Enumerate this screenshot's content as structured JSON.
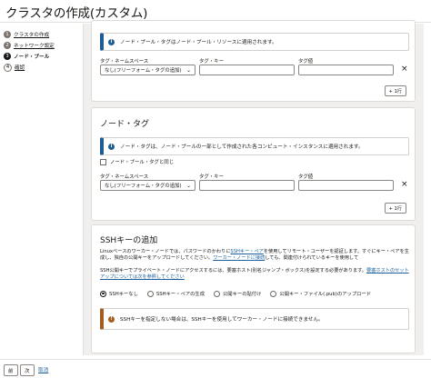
{
  "page": {
    "title": "クラスタの作成(カスタム)"
  },
  "steps": [
    {
      "num": "1",
      "label": "クラスタの作成"
    },
    {
      "num": "2",
      "label": "ネットワーク設定"
    },
    {
      "num": "3",
      "label": "ノード・プール"
    },
    {
      "num": "4",
      "label": "確認"
    }
  ],
  "pool_tags": {
    "info": "ノード・プール・タグはノード・プール・リソースに適用されます。",
    "namespace_label": "タグ・ネームスペース",
    "key_label": "タグ・キー",
    "value_label": "タグ値",
    "namespace_value": "なし(フリーフォーム・タグの追加)",
    "add_row": "+ 1行"
  },
  "node_tags": {
    "title": "ノード・タグ",
    "info": "ノード・タグは、ノード・プールの一部として作成された各コンピュート・インスタンスに適用されます。",
    "same_checkbox": "ノード・プール・タグと同じ",
    "namespace_label": "タグ・ネームスペース",
    "key_label": "タグ・キー",
    "value_label": "タグ値",
    "namespace_value": "なし(フリーフォーム・タグの追加)",
    "add_row": "+ 1行"
  },
  "ssh": {
    "title": "SSHキーの追加",
    "p1_pre": "Linuxベースのワーカー・ノードでは、パスワードのかわりに",
    "p1_link1": "SSHキー・ペア",
    "p1_mid": "を使用してリモート・ユーザーを認証します。すぐにキー・ペアを生成し、独自の公開キーをアップロードしてください。",
    "p1_link2": "ワーカー・ノードに接続",
    "p1_post": "しても、関連付けられているキーを使用して",
    "p2_pre": "SSH公開キーでプライベート・ノードにアクセスするには、要塞ホスト(別名ジャンプ・ボックス)を設定する必要があります。",
    "p2_link": "要塞ホストのセットアップについては次を参照してください",
    "options": [
      "SSHキーなし",
      "SSHキー・ペアの生成",
      "公開キーの貼付け",
      "公開キー・ファイル(.pub)のアップロード"
    ],
    "selected_index": 0,
    "warning": "SSHキーを指定しない場合は、SSHキーを使用してワーカー・ノードに接続できません。"
  },
  "footer": {
    "back": "前",
    "next": "次",
    "cancel": "取消"
  },
  "icons": {
    "info": "info-icon",
    "close": "close-icon",
    "dropdown": "chevron-down-icon"
  },
  "colors": {
    "info_accent": "#1e5d94",
    "warning_accent": "#a45d1c",
    "link": "#1a5f9b"
  }
}
